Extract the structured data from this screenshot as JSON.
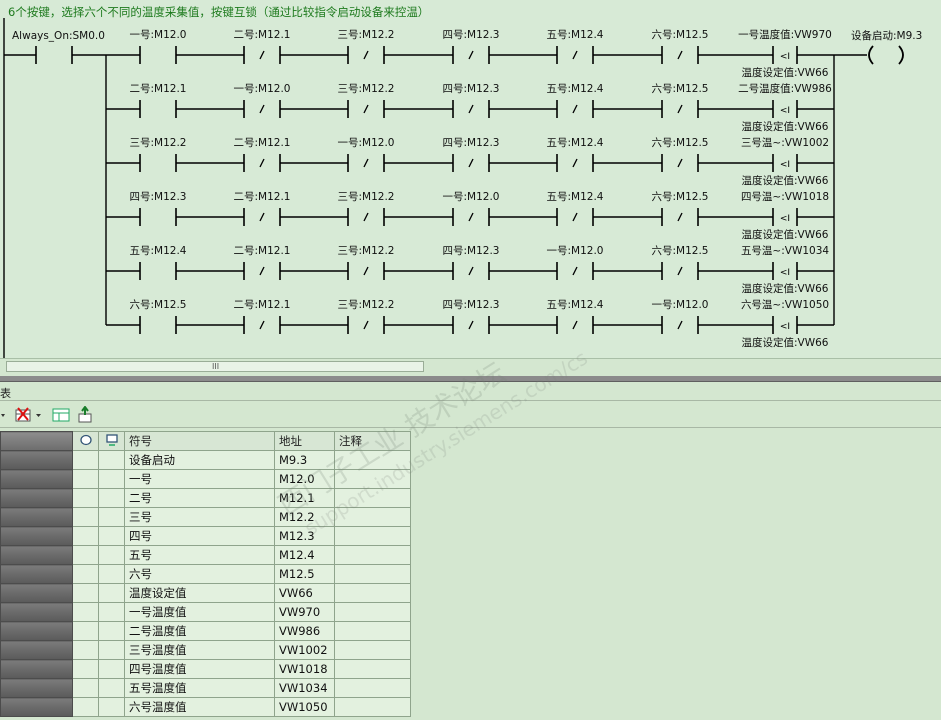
{
  "network_comment": "6个按键，选择六个不同的温度采集值，按键互锁（通过比较指令启动设备来控温）",
  "always_on": "Always_On:SM0.0",
  "coil": {
    "label": "设备启动:M9.3",
    "symbol": "( )"
  },
  "rows": [
    {
      "contacts": [
        "一号:M12.0",
        "二号:M12.1",
        "三号:M12.2",
        "四号:M12.3",
        "五号:M12.4",
        "六号:M12.5"
      ],
      "compare_top": "一号温度值:VW970",
      "compare_op": "<I",
      "compare_bottom": "温度设定值:VW66"
    },
    {
      "contacts": [
        "二号:M12.1",
        "一号:M12.0",
        "三号:M12.2",
        "四号:M12.3",
        "五号:M12.4",
        "六号:M12.5"
      ],
      "compare_top": "二号温度值:VW986",
      "compare_op": "<I",
      "compare_bottom": "温度设定值:VW66"
    },
    {
      "contacts": [
        "三号:M12.2",
        "二号:M12.1",
        "一号:M12.0",
        "四号:M12.3",
        "五号:M12.4",
        "六号:M12.5"
      ],
      "compare_top": "三号温~:VW1002",
      "compare_op": "<I",
      "compare_bottom": "温度设定值:VW66"
    },
    {
      "contacts": [
        "四号:M12.3",
        "二号:M12.1",
        "三号:M12.2",
        "一号:M12.0",
        "五号:M12.4",
        "六号:M12.5"
      ],
      "compare_top": "四号温~:VW1018",
      "compare_op": "<I",
      "compare_bottom": "温度设定值:VW66"
    },
    {
      "contacts": [
        "五号:M12.4",
        "二号:M12.1",
        "三号:M12.2",
        "四号:M12.3",
        "一号:M12.0",
        "六号:M12.5"
      ],
      "compare_top": "五号温~:VW1034",
      "compare_op": "<I",
      "compare_bottom": "温度设定值:VW66"
    },
    {
      "contacts": [
        "六号:M12.5",
        "二号:M12.1",
        "三号:M12.2",
        "四号:M12.3",
        "五号:M12.4",
        "一号:M12.0"
      ],
      "compare_top": "六号温~:VW1050",
      "compare_op": "<I",
      "compare_bottom": "温度设定值:VW66"
    }
  ],
  "scroll_grip": "III",
  "panel_title": "表",
  "toolbar": {
    "icons": [
      "dropdown-arrow-icon",
      "delete-row-icon",
      "new-table-icon",
      "export-icon"
    ]
  },
  "table": {
    "headers": [
      "符号",
      "地址",
      "注释"
    ],
    "rows": [
      {
        "symbol": "设备启动",
        "address": "M9.3",
        "comment": ""
      },
      {
        "symbol": "一号",
        "address": "M12.0",
        "comment": ""
      },
      {
        "symbol": "二号",
        "address": "M12.1",
        "comment": ""
      },
      {
        "symbol": "三号",
        "address": "M12.2",
        "comment": ""
      },
      {
        "symbol": "四号",
        "address": "M12.3",
        "comment": ""
      },
      {
        "symbol": "五号",
        "address": "M12.4",
        "comment": ""
      },
      {
        "symbol": "六号",
        "address": "M12.5",
        "comment": ""
      },
      {
        "symbol": "温度设定值",
        "address": "VW66",
        "comment": ""
      },
      {
        "symbol": "一号温度值",
        "address": "VW970",
        "comment": ""
      },
      {
        "symbol": "二号温度值",
        "address": "VW986",
        "comment": ""
      },
      {
        "symbol": "三号温度值",
        "address": "VW1002",
        "comment": ""
      },
      {
        "symbol": "四号温度值",
        "address": "VW1018",
        "comment": ""
      },
      {
        "symbol": "五号温度值",
        "address": "VW1034",
        "comment": ""
      },
      {
        "symbol": "六号温度值",
        "address": "VW1050",
        "comment": ""
      }
    ]
  },
  "watermark": {
    "line1": "西门子工业  技术论坛",
    "line2": "support.industry.siemens.com/cs"
  },
  "colors": {
    "background": "#d4e7d0",
    "comment_text": "#1d7a1d",
    "wire": "#000000"
  }
}
